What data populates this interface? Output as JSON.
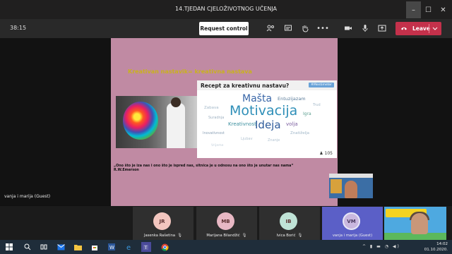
{
  "window": {
    "title": "14.TJEDAN CJELOŽIVOTNOG UČENJA",
    "buttons": {
      "minimize": "–",
      "maximize": "☐",
      "close": "✕"
    }
  },
  "toolbar": {
    "timer": "38:15",
    "request_control": "Request control",
    "leave": "Leave"
  },
  "slide": {
    "title": "Kreativan nastavik= kreativna nastava",
    "wordcloud": {
      "title": "Recept za kreativnu nastavu?",
      "badge": "#Mentimeter",
      "count": "105",
      "words": [
        "Mašta",
        "Motivacija",
        "Ideja",
        "Kreativnost",
        "Entuzijazam",
        "volja",
        "Inovativnost",
        "Znatiželja",
        "Igra",
        "Zabava",
        "Suradnja",
        "Trud",
        "Ljubav",
        "Znanje",
        "Vrijeme"
      ]
    },
    "quote": "„Ono što je iza nas i ono što je ispred nas, sitnica je u odnosu na ono što je unutar nas nama“",
    "author": "R.W.Emerson"
  },
  "stage": {
    "guest_label": "vanja i marija (Guest)"
  },
  "participants": [
    {
      "initials": "JR",
      "name": "Jasenka Rašetina",
      "color": "#f3c6bf"
    },
    {
      "initials": "MB",
      "name": "Marijana Bilandžić",
      "color": "#e8b8c4"
    },
    {
      "initials": "IB",
      "name": "Ivica Borić",
      "color": "#bfe3d6"
    },
    {
      "initials": "VM",
      "name": "vanja i marija (Guest)",
      "color": "#c9b8df"
    }
  ],
  "taskbar": {
    "time": "14:02",
    "date": "01.10.2020."
  }
}
